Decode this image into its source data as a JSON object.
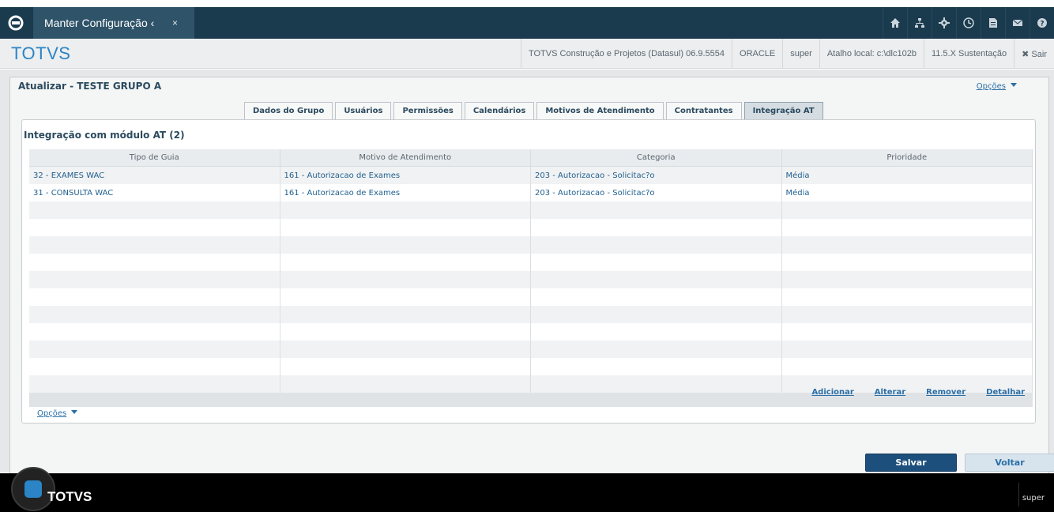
{
  "window": {
    "tab_title": "Manter Configuração ‹",
    "tab_close": "×"
  },
  "header": {
    "brand": "TOTVS",
    "system": "TOTVS Construção e Projetos (Datasul) 06.9.5554",
    "database": "ORACLE",
    "user": "super",
    "shortcut": "Atalho local: c:\\dlc102b",
    "version": "11.5.X Sustentação",
    "exit": "✖ Sair"
  },
  "page": {
    "title": "Atualizar - TESTE GRUPO A",
    "options_top": "Opções",
    "options_bottom": "Opções"
  },
  "tabs": [
    {
      "label": "Dados do Grupo",
      "active": false
    },
    {
      "label": "Usuários",
      "active": false
    },
    {
      "label": "Permissões",
      "active": false
    },
    {
      "label": "Calendários",
      "active": false
    },
    {
      "label": "Motivos de Atendimento",
      "active": false
    },
    {
      "label": "Contratantes",
      "active": false
    },
    {
      "label": "Integração AT",
      "active": true
    }
  ],
  "section": {
    "title": "Integração com módulo AT (2)"
  },
  "grid": {
    "columns": [
      "Tipo de Guia",
      "Motivo de Atendimento",
      "Categoria",
      "Prioridade"
    ],
    "rows": [
      [
        "32 - EXAMES WAC",
        "161 - Autorizacao de Exames",
        "203 - Autorizacao - Solicitac?o",
        "Média"
      ],
      [
        "31 - CONSULTA WAC",
        "161 - Autorizacao de Exames",
        "203 - Autorizacao - Solicitac?o",
        "Média"
      ],
      [
        "",
        "",
        "",
        ""
      ],
      [
        "",
        "",
        "",
        ""
      ],
      [
        "",
        "",
        "",
        ""
      ],
      [
        "",
        "",
        "",
        ""
      ],
      [
        "",
        "",
        "",
        ""
      ],
      [
        "",
        "",
        "",
        ""
      ],
      [
        "",
        "",
        "",
        ""
      ],
      [
        "",
        "",
        "",
        ""
      ],
      [
        "",
        "",
        "",
        ""
      ],
      [
        "",
        "",
        "",
        ""
      ],
      [
        "",
        "",
        "",
        ""
      ]
    ]
  },
  "actions": {
    "add": "Adicionar",
    "edit": "Alterar",
    "remove": "Remover",
    "detail": "Detalhar"
  },
  "buttons": {
    "save": "Salvar",
    "back": "Voltar"
  },
  "footer": {
    "brand": "TOTVS",
    "user": "super"
  },
  "icons": [
    "home-icon",
    "sitemap-icon",
    "gear-icon",
    "clock-icon",
    "document-icon",
    "mail-icon",
    "help-icon"
  ],
  "colors": {
    "topbar": "#1a3a4e",
    "brand": "#2a84c6",
    "link": "#2a6fa8",
    "save_button": "#1d4f7c"
  }
}
